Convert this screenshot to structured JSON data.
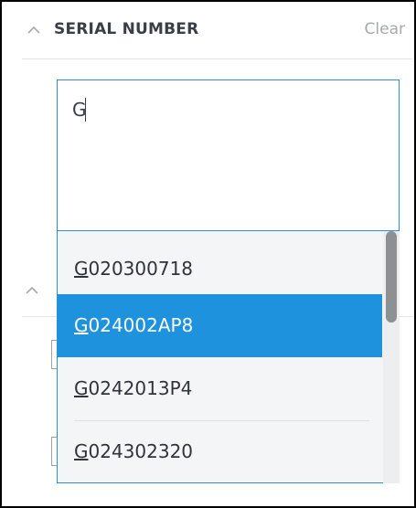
{
  "section": {
    "title": "SERIAL NUMBER",
    "clear_label": "Clear",
    "collapse_icon": "chevron-up-icon"
  },
  "search": {
    "value": "G"
  },
  "suggestions": [
    {
      "match": "G",
      "rest": "020300718",
      "selected": false
    },
    {
      "match": "G",
      "rest": "024002AP8",
      "selected": true
    },
    {
      "match": "G",
      "rest": "0242013P4",
      "selected": false
    },
    {
      "match": "G",
      "rest": "024302320",
      "selected": false
    }
  ],
  "colors": {
    "accent": "#1f92de",
    "focus_border": "#2d8fd8",
    "title_text": "#3a3f47",
    "muted_text": "#a6a9ad"
  }
}
